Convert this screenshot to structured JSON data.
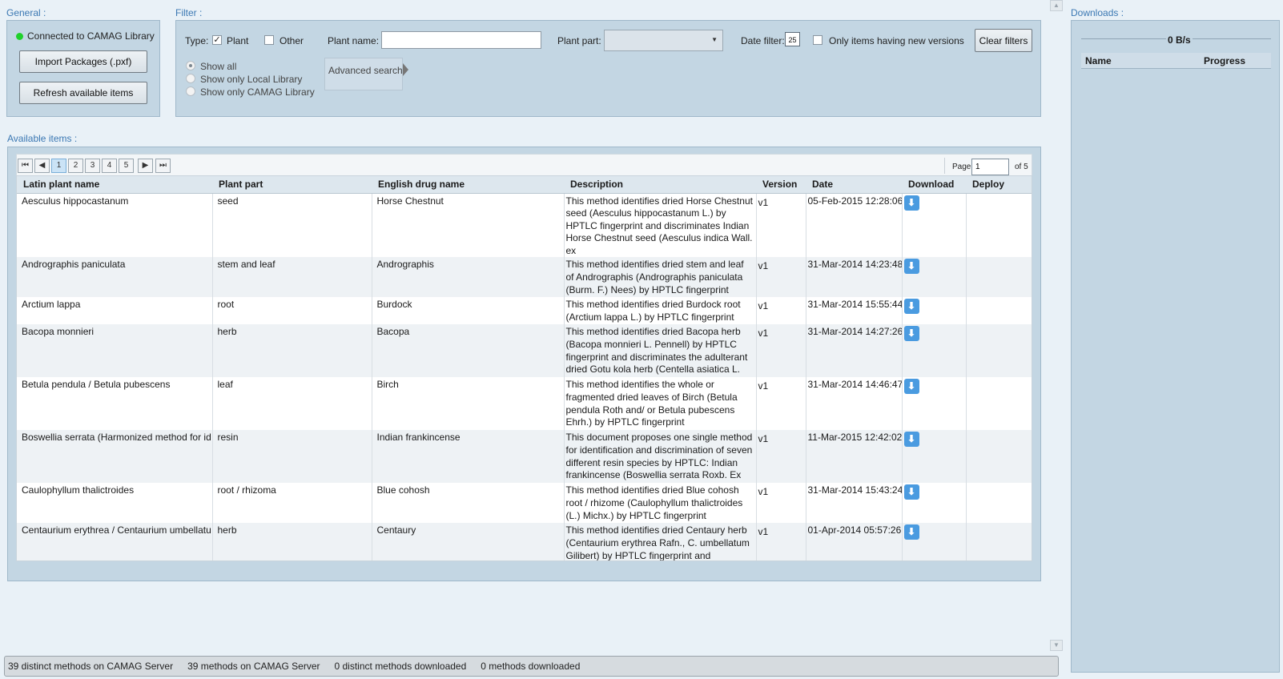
{
  "general": {
    "label": "General :",
    "status": "Connected to CAMAG Library",
    "status_color": "#1fd12b",
    "import_button": "Import Packages (.pxf)",
    "refresh_button": "Refresh available items"
  },
  "filter": {
    "label": "Filter :",
    "type_label": "Type:",
    "plant_label": "Plant",
    "plant_checked": true,
    "other_label": "Other",
    "other_checked": false,
    "plant_name_label": "Plant name:",
    "plant_name_value": "",
    "plant_part_label": "Plant part:",
    "plant_part_value": "",
    "date_filter_label": "Date filter:",
    "calendar_day": "25",
    "new_versions_label": "Only items having new versions",
    "clear_button": "Clear filters",
    "scope_options": [
      "Show all",
      "Show only Local Library",
      "Show only CAMAG Library"
    ],
    "scope_selected": 0,
    "advanced_search": "Advanced search"
  },
  "available": {
    "label": "Available items :",
    "pages": [
      "1",
      "2",
      "3",
      "4",
      "5"
    ],
    "current_page_index": 0,
    "page_label": "Page",
    "page_value": "1",
    "of_label": "of 5",
    "columns": [
      "Latin plant name",
      "Plant part",
      "English drug name",
      "Description",
      "Version",
      "Date",
      "Download",
      "Deploy"
    ],
    "rows": [
      {
        "latin": "Aesculus hippocastanum",
        "part": "seed",
        "english": "Horse Chestnut",
        "desc": "This method identifies dried Horse Chestnut seed (Aesculus hippocastanum L.) by HPTLC fingerprint and discriminates Indian Horse Chestnut seed (Aesculus indica Wall. ex",
        "version": "v1",
        "date": "05-Feb-2015 12:28:06"
      },
      {
        "latin": "Andrographis paniculata",
        "part": "stem and leaf",
        "english": "Andrographis",
        "desc": "This method identifies dried stem and leaf of Andrographis (Andrographis paniculata (Burm. F.) Nees) by HPTLC fingerprint",
        "version": "v1",
        "date": "31-Mar-2014 14:23:48"
      },
      {
        "latin": "Arctium lappa",
        "part": "root",
        "english": "Burdock",
        "desc": "This method identifies dried Burdock root (Arctium lappa L.) by HPTLC fingerprint",
        "version": "v1",
        "date": "31-Mar-2014 15:55:44"
      },
      {
        "latin": "Bacopa monnieri",
        "part": "herb",
        "english": "Bacopa",
        "desc": "This method identifies dried Bacopa herb (Bacopa monnieri L. Pennell) by HPTLC fingerprint and discriminates the adulterant dried Gotu kola herb (Centella asiatica L.",
        "version": "v1",
        "date": "31-Mar-2014 14:27:26"
      },
      {
        "latin": "Betula pendula / Betula pubescens",
        "part": "leaf",
        "english": "Birch",
        "desc": "This method identifies the whole or fragmented dried leaves of Birch (Betula pendula Roth and/ or Betula pubescens Ehrh.) by HPTLC fingerprint",
        "version": "v1",
        "date": "31-Mar-2014 14:46:47"
      },
      {
        "latin": "Boswellia serrata (Harmonized method for id",
        "part": "resin",
        "english": "Indian frankincense",
        "desc": "This document proposes one single method for identification and discrimination of seven different resin species by HPTLC: Indian frankincense (Boswellia serrata Roxb. Ex",
        "version": "v1",
        "date": "11-Mar-2015 12:42:02"
      },
      {
        "latin": "Caulophyllum thalictroides",
        "part": "root / rhizoma",
        "english": "Blue cohosh",
        "desc": "This method identifies dried Blue cohosh root / rhizome (Caulophyllum thalictroides (L.) Michx.) by HPTLC fingerprint",
        "version": "v1",
        "date": "31-Mar-2014 15:43:24"
      },
      {
        "latin": "Centaurium erythrea / Centaurium umbellatu",
        "part": "herb",
        "english": "Centaury",
        "desc": "This method identifies dried Centaury herb (Centaurium erythrea Rafn., C. umbellatum Gilibert) by HPTLC fingerprint and discriminates the adulterants dried Gentian",
        "version": "v1",
        "date": "01-Apr-2014 05:57:26"
      }
    ]
  },
  "downloads": {
    "label": "Downloads :",
    "speed": "0 B/s",
    "col_name": "Name",
    "col_progress": "Progress"
  },
  "status_bar": {
    "distinct_server": "39 distinct methods on CAMAG Server",
    "methods_server": "39 methods on CAMAG Server",
    "distinct_downloaded": "0 distinct methods downloaded",
    "methods_downloaded": "0 methods downloaded"
  }
}
